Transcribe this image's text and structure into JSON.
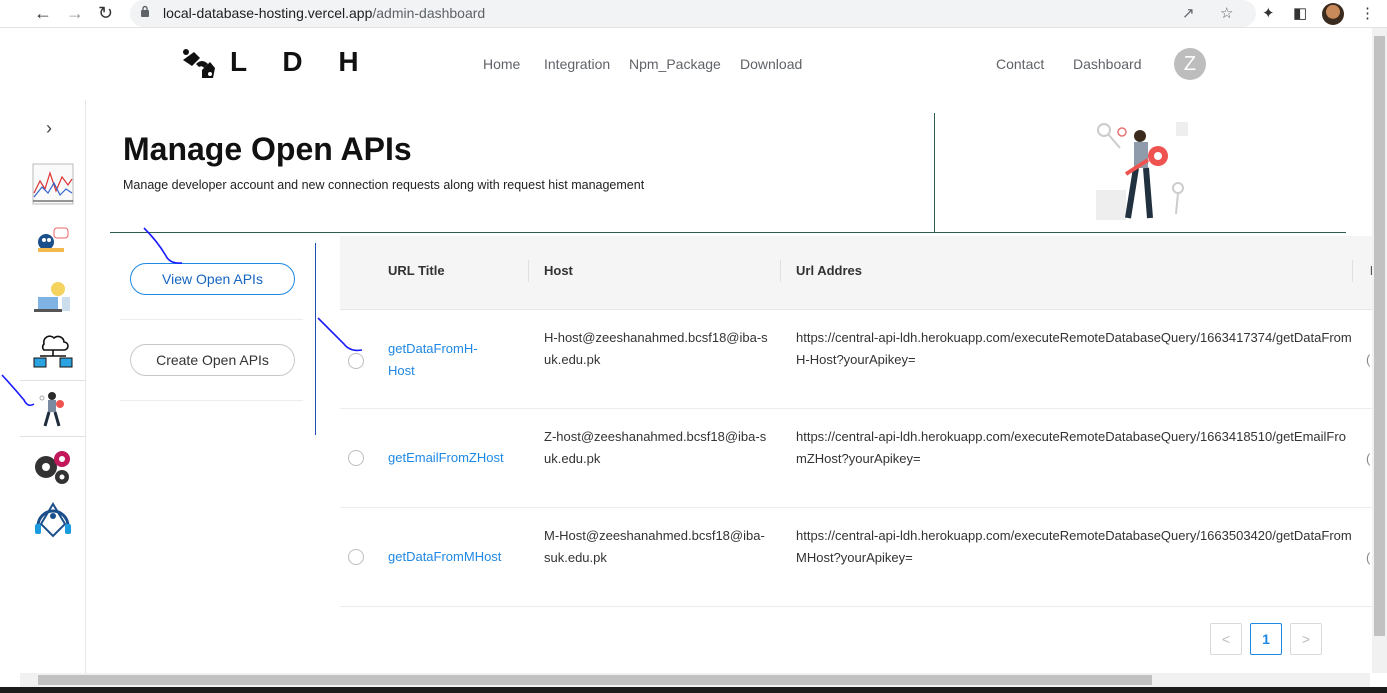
{
  "browser": {
    "url_host": "local-database-hosting.vercel.app",
    "url_path": "/admin-dashboard"
  },
  "app": {
    "logo_text": "L D H",
    "nav": [
      "Home",
      "Integration",
      "Npm_Package",
      "Download"
    ],
    "nav_right": [
      "Contact",
      "Dashboard"
    ],
    "profile_initial": "Z"
  },
  "hero": {
    "title": "Manage Open APIs",
    "subtitle": "Manage developer account and new connection requests along with request hist management"
  },
  "actions": {
    "view": "View Open APIs",
    "create": "Create Open APIs"
  },
  "table": {
    "columns": [
      "URL Title",
      "Host",
      "Url Addres"
    ],
    "truncated_col_char": "I",
    "rows": [
      {
        "title": "getDataFromH-Host",
        "host": "H-host@zeeshanahmed.bcsf18@iba-suk.edu.pk",
        "url": "https://central-api-ldh.herokuapp.com/executeRemoteDatabaseQuery/1663417374/getDataFromH-Host?yourApikey=",
        "trailing": "("
      },
      {
        "title": "getEmailFromZHost",
        "host": "Z-host@zeeshanahmed.bcsf18@iba-suk.edu.pk",
        "url": "https://central-api-ldh.herokuapp.com/executeRemoteDatabaseQuery/1663418510/getEmailFromZHost?yourApikey=",
        "trailing": "("
      },
      {
        "title": "getDataFromMHost",
        "host": "M-Host@zeeshanahmed.bcsf18@iba-suk.edu.pk",
        "url": "https://central-api-ldh.herokuapp.com/executeRemoteDatabaseQuery/1663503420/getDataFromMHost?yourApikey=",
        "trailing": "("
      }
    ]
  },
  "pagination": {
    "prev": "<",
    "current": "1",
    "next": ">"
  },
  "colors": {
    "accent": "#1e88e5",
    "divider": "#2f5d50"
  }
}
